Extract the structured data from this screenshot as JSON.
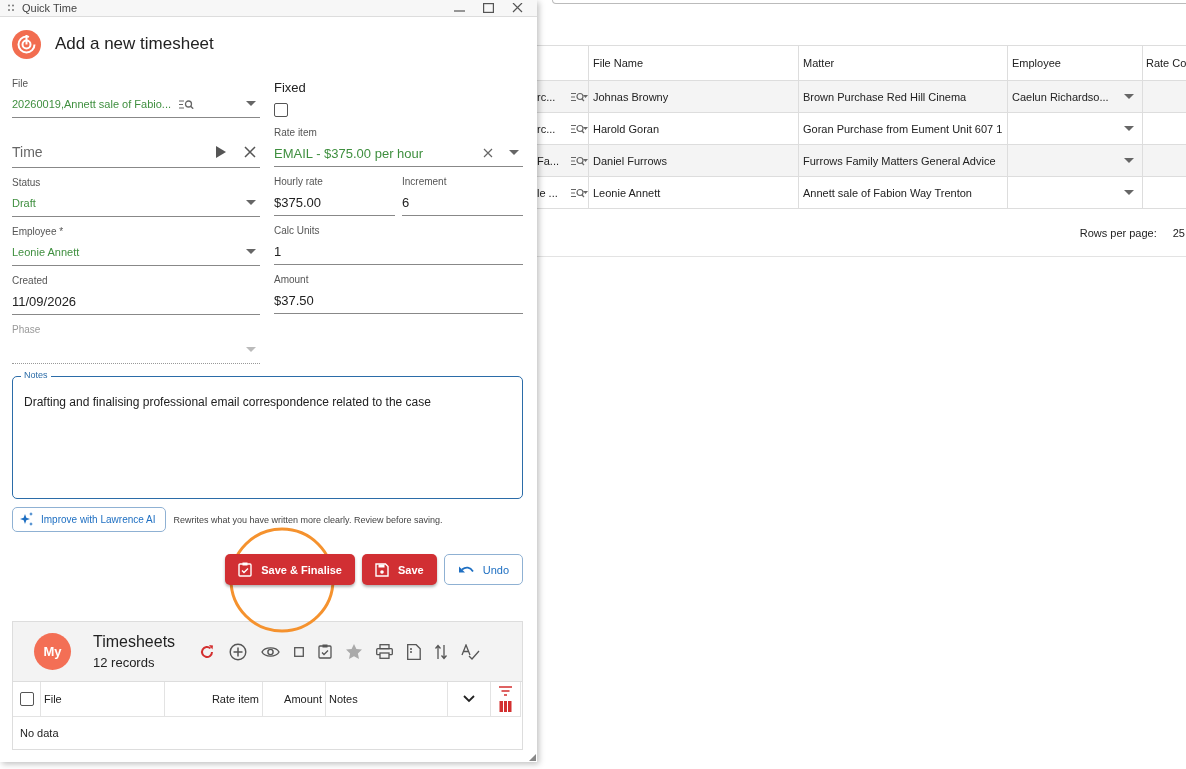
{
  "window": {
    "title": "Quick Time"
  },
  "dialog": {
    "heading": "Add a new timesheet",
    "left_fields": [
      {
        "kind": "lookup",
        "label": "File",
        "value": "20260019,Annett sale of Fabio..."
      },
      {
        "kind": "timer",
        "placeholder": "Time"
      },
      {
        "kind": "select",
        "label": "Status",
        "value": "Draft",
        "disabled": false
      },
      {
        "kind": "select",
        "label": "Employee *",
        "value": "Leonie Annett",
        "disabled": false
      },
      {
        "kind": "text",
        "label": "Created",
        "value": "11/09/2026"
      },
      {
        "kind": "select",
        "label": "Phase",
        "disabled": true
      }
    ],
    "right_fields": [
      {
        "kind": "checkbox",
        "label": "Fixed",
        "checked": false
      },
      {
        "kind": "clearable",
        "label": "Rate item",
        "value": "EMAIL - $375.00 per hour"
      },
      {
        "kind": "pair",
        "items": [
          {
            "label": "Hourly rate",
            "value": "$375.00"
          },
          {
            "label": "Increment",
            "value": "6"
          }
        ]
      },
      {
        "kind": "text",
        "label": "Calc Units",
        "value": "1"
      },
      {
        "kind": "text",
        "label": "Amount",
        "value": "$37.50"
      }
    ],
    "notes": {
      "label": "Notes",
      "value": "Drafting and finalising professional email correspondence related to the case"
    },
    "ai_button": "Improve with Lawrence AI",
    "ai_hint": "Rewrites what you have written more clearly. Review before saving.",
    "buttons": [
      {
        "kind": "finalise",
        "label": "Save & Finalise"
      },
      {
        "kind": "save",
        "label": "Save"
      },
      {
        "kind": "undo",
        "label": "Undo"
      }
    ],
    "timesheets": {
      "avatar": "My",
      "title": "Timesheets",
      "count": "12 records",
      "select_all_checked": false,
      "columns": [
        "File",
        "Rate item",
        "Amount",
        "Notes"
      ],
      "empty": "No data"
    }
  },
  "background_table": {
    "columns": [
      "",
      "File Name",
      "Matter",
      "Employee",
      "Rate Co"
    ],
    "rows": [
      {
        "column_1": "rc...",
        "file_name": "Johnas Browny",
        "matter": "Brown Purchase Red Hill Cinema",
        "employee": "Caelun Richardso..."
      },
      {
        "column_1": "rc...",
        "file_name": "Harold Goran",
        "matter": "Goran Purchase from Eument Unit 607 1"
      },
      {
        "column_1": "Fa...",
        "file_name": "Daniel Furrows",
        "matter": "Furrows Family Matters General Advice"
      },
      {
        "column_1": "le ...",
        "file_name": "Leonie Annett",
        "matter": "Annett sale of Fabion Way Trenton"
      }
    ],
    "rows_per_page_label": "Rows per page:",
    "rows_per_page": "25"
  }
}
